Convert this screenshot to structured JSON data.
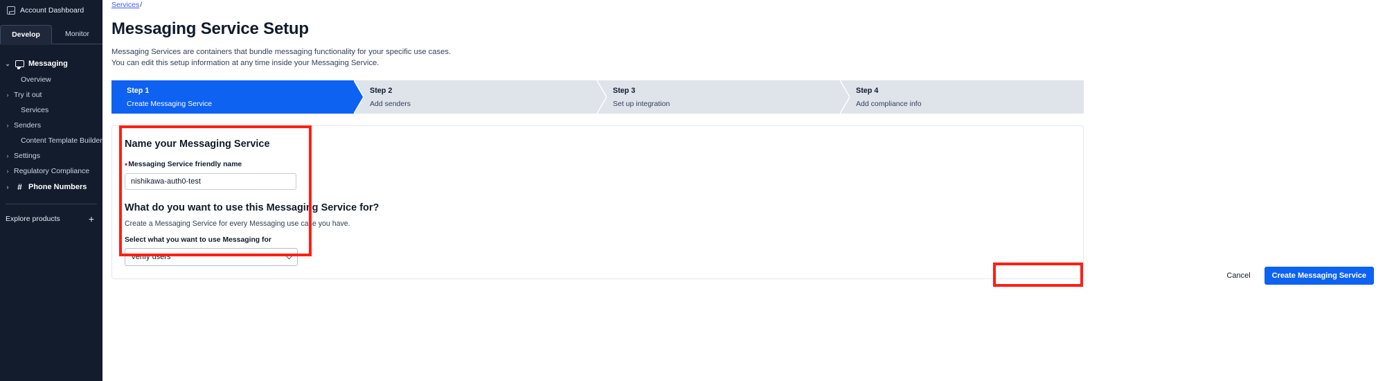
{
  "sidebar": {
    "account_dashboard": "Account Dashboard",
    "tabs": [
      {
        "label": "Develop",
        "active": true
      },
      {
        "label": "Monitor",
        "active": false
      }
    ],
    "groups": [
      {
        "label": "Messaging",
        "icon": "chat-icon",
        "caret": "⌄",
        "items": [
          {
            "label": "Overview",
            "caret": ""
          },
          {
            "label": "Try it out",
            "caret": "›"
          },
          {
            "label": "Services",
            "caret": ""
          },
          {
            "label": "Senders",
            "caret": "›"
          },
          {
            "label": "Content Template Builder",
            "caret": ""
          },
          {
            "label": "Settings",
            "caret": "›"
          },
          {
            "label": "Regulatory Compliance",
            "caret": "›"
          }
        ]
      }
    ],
    "phone_numbers": {
      "label": "Phone Numbers",
      "caret": "›",
      "icon": "hash-icon"
    },
    "explore_products": "Explore products",
    "explore_plus": "+"
  },
  "breadcrumb": {
    "link": "Services",
    "separator": "/"
  },
  "header": {
    "title": "Messaging Service Setup",
    "lede_line1": "Messaging Services are containers that bundle messaging functionality for your specific use cases.",
    "lede_line2": "You can edit this setup information at any time inside your Messaging Service."
  },
  "stepper": [
    {
      "num": "Step 1",
      "label": "Create Messaging Service",
      "active": true
    },
    {
      "num": "Step 2",
      "label": "Add senders",
      "active": false
    },
    {
      "num": "Step 3",
      "label": "Set up integration",
      "active": false
    },
    {
      "num": "Step 4",
      "label": "Add compliance info",
      "active": false
    }
  ],
  "form": {
    "section1_title": "Name your Messaging Service",
    "friendly_name_label": "Messaging Service friendly name",
    "friendly_name_required_marker": "•",
    "friendly_name_value": "nishikawa-auth0-test",
    "friendly_name_placeholder": "",
    "section2_title": "What do you want to use this Messaging Service for?",
    "section2_helper": "Create a Messaging Service for every Messaging use case you have.",
    "select_label": "Select what you want to use Messaging for",
    "select_value": "Verify users",
    "select_options": [
      "Verify users"
    ]
  },
  "footer": {
    "cancel_label": "Cancel",
    "submit_label": "Create Messaging Service"
  },
  "colors": {
    "accent_blue": "#0d62f2",
    "sidebar_bg": "#121c2d",
    "step_inactive_bg": "#dfe3ea",
    "annotation_red": "#ff1e13",
    "link_blue": "#3b5bfd"
  }
}
